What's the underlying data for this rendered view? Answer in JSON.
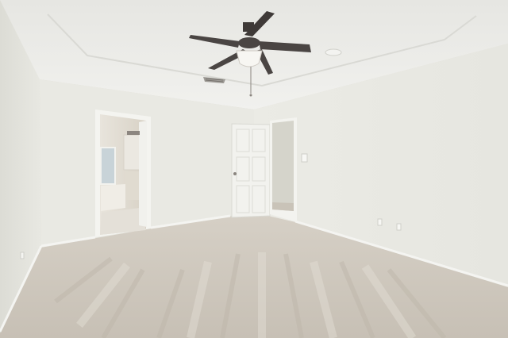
{
  "scene": {
    "kind": "photo",
    "subject": "empty bedroom",
    "colors": {
      "ceiling": "#ececea",
      "left_wall": "#e4e4de",
      "back_wall": "#e9e9e3",
      "right_wall": "#ebebe6",
      "carpet": "#cfc8bd",
      "door": "#f2f2ee",
      "bath_tile": "#dcd7cd",
      "fan_blade": "#4a4543",
      "trim": "#f4f4f1"
    },
    "objects": [
      "ceiling-fan",
      "air-vent",
      "bathroom-doorway",
      "open-door",
      "closet-doorway",
      "light-switch",
      "wall-outlets",
      "carpet"
    ]
  }
}
